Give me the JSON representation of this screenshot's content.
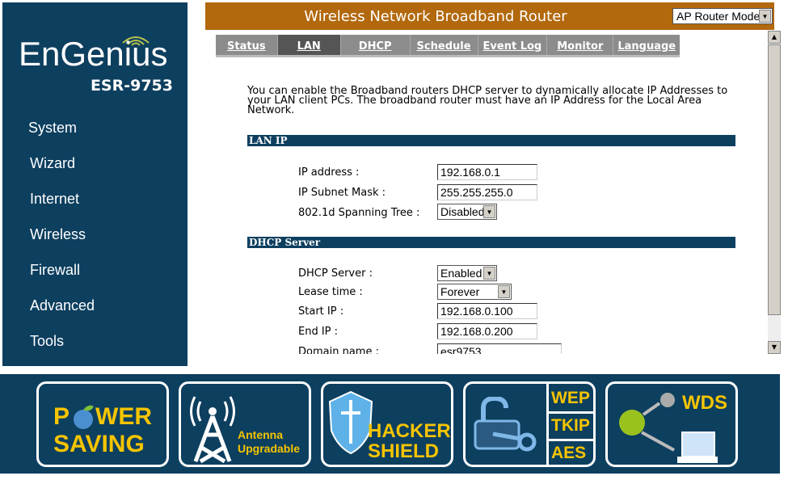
{
  "brand": {
    "logo": "EnGenius",
    "model": "ESR-9753"
  },
  "sidebar": {
    "items": [
      {
        "label": "System"
      },
      {
        "label": "Wizard"
      },
      {
        "label": "Internet"
      },
      {
        "label": "Wireless"
      },
      {
        "label": "Firewall"
      },
      {
        "label": "Advanced"
      },
      {
        "label": "Tools"
      }
    ]
  },
  "header": {
    "title": "Wireless Network Broadband Router",
    "mode": "AP Router Mode"
  },
  "tabs": [
    {
      "label": "Status"
    },
    {
      "label": "LAN",
      "active": true
    },
    {
      "label": "DHCP"
    },
    {
      "label": "Schedule"
    },
    {
      "label": "Event Log"
    },
    {
      "label": "Monitor"
    },
    {
      "label": "Language"
    }
  ],
  "main": {
    "intro": "You can enable the Broadband routers DHCP server to dynamically allocate IP Addresses to your LAN client PCs. The broadband router must have an IP Address for the Local Area Network.",
    "lan": {
      "title": "LAN IP",
      "ip_label": "IP address :",
      "ip": "192.168.0.1",
      "mask_label": "IP Subnet Mask :",
      "mask": "255.255.255.0",
      "stp_label": "802.1d Spanning Tree :",
      "stp": "Disabled"
    },
    "dhcp": {
      "title": "DHCP Server",
      "server_label": "DHCP Server :",
      "server": "Enabled",
      "lease_label": "Lease time :",
      "lease": "Forever",
      "start_label": "Start IP :",
      "start": "192.168.0.100",
      "end_label": "End IP :",
      "end": "192.168.0.200",
      "domain_label": "Domain name :",
      "domain": "esr9753"
    }
  },
  "banner": {
    "power": [
      "P",
      "WER",
      "SAVING"
    ],
    "antenna": [
      "Antenna",
      "Upgradable"
    ],
    "hacker": [
      "HACKER",
      "SHIELD"
    ],
    "security": [
      "WEP",
      "TKIP",
      "AES"
    ],
    "wds": "WDS"
  },
  "colors": {
    "navy": "#0d3f5f",
    "orange": "#b2680c",
    "yellow": "#f5c400"
  }
}
